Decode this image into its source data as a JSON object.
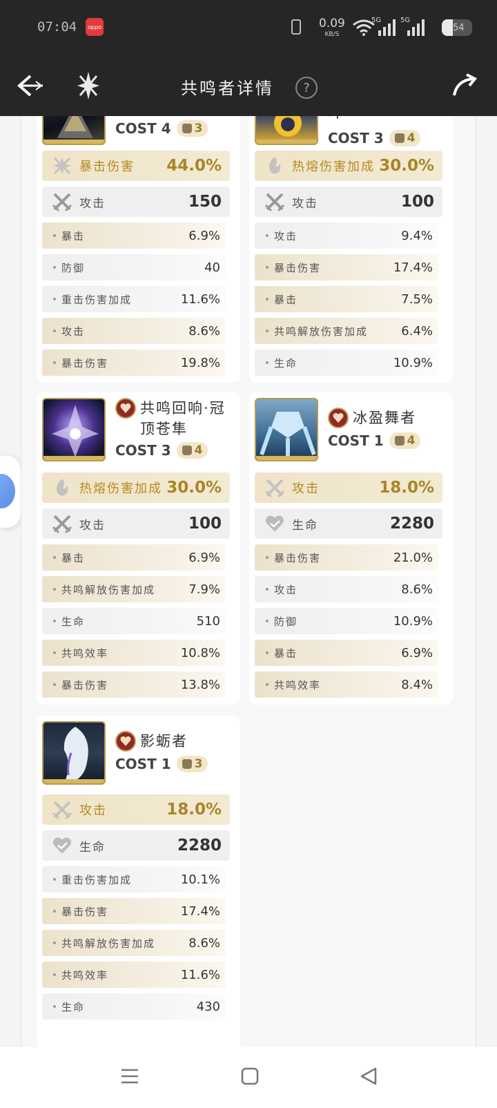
{
  "status_bar": {
    "time": "07:04",
    "app_badge": "oppo",
    "net_speed": "0.09",
    "net_unit": "KB/S",
    "sig1": "5G",
    "sig2": "5G",
    "battery": "54"
  },
  "header": {
    "title": "共鸣者详情",
    "help": "?"
  },
  "cards": [
    {
      "name": "",
      "cost": "COST 4",
      "rank": "3",
      "main": {
        "label": "暴击伤害",
        "value": "44.0%"
      },
      "sub_main": {
        "label": "攻击",
        "value": "150"
      },
      "substats": [
        {
          "label": "暴击",
          "value": "6.9%"
        },
        {
          "label": "防御",
          "value": "40"
        },
        {
          "label": "重击伤害加成",
          "value": "11.6%"
        },
        {
          "label": "攻击",
          "value": "8.6%"
        },
        {
          "label": "暴击伤害",
          "value": "19.8%"
        }
      ]
    },
    {
      "name": "叶",
      "cost": "COST 3",
      "rank": "4",
      "main": {
        "label": "热熔伤害加成",
        "value": "30.0%"
      },
      "sub_main": {
        "label": "攻击",
        "value": "100"
      },
      "substats": [
        {
          "label": "攻击",
          "value": "9.4%"
        },
        {
          "label": "暴击伤害",
          "value": "17.4%"
        },
        {
          "label": "暴击",
          "value": "7.5%"
        },
        {
          "label": "共鸣解放伤害加成",
          "value": "6.4%"
        },
        {
          "label": "生命",
          "value": "10.9%"
        }
      ]
    },
    {
      "name": "共鸣回响·冠顶苍隼",
      "cost": "COST 3",
      "rank": "4",
      "main": {
        "label": "热熔伤害加成",
        "value": "30.0%"
      },
      "sub_main": {
        "label": "攻击",
        "value": "100"
      },
      "substats": [
        {
          "label": "暴击",
          "value": "6.9%"
        },
        {
          "label": "共鸣解放伤害加成",
          "value": "7.9%"
        },
        {
          "label": "生命",
          "value": "510"
        },
        {
          "label": "共鸣效率",
          "value": "10.8%"
        },
        {
          "label": "暴击伤害",
          "value": "13.8%"
        }
      ]
    },
    {
      "name": "冰盈舞者",
      "cost": "COST 1",
      "rank": "4",
      "main": {
        "label": "攻击",
        "value": "18.0%"
      },
      "sub_main": {
        "label": "生命",
        "value": "2280"
      },
      "substats": [
        {
          "label": "暴击伤害",
          "value": "21.0%"
        },
        {
          "label": "攻击",
          "value": "8.6%"
        },
        {
          "label": "防御",
          "value": "10.9%"
        },
        {
          "label": "暴击",
          "value": "6.9%"
        },
        {
          "label": "共鸣效率",
          "value": "8.4%"
        }
      ]
    },
    {
      "name": "影蛎者",
      "cost": "COST 1",
      "rank": "3",
      "main": {
        "label": "攻击",
        "value": "18.0%"
      },
      "sub_main": {
        "label": "生命",
        "value": "2280"
      },
      "substats": [
        {
          "label": "重击伤害加成",
          "value": "10.1%"
        },
        {
          "label": "暴击伤害",
          "value": "17.4%"
        },
        {
          "label": "共鸣解放伤害加成",
          "value": "8.6%"
        },
        {
          "label": "共鸣效率",
          "value": "11.6%"
        },
        {
          "label": "生命",
          "value": "430"
        }
      ]
    }
  ],
  "colors": {
    "accent_gold": "#a88626",
    "main_stat_bg": "#efe4c8",
    "header_bg": "#262626"
  },
  "icons": {
    "back": "back-arrow-icon",
    "logo": "game-logo-icon",
    "help": "help-circle-icon",
    "share": "share-arrow-icon",
    "crit": "crit-burst-icon",
    "fusion": "fusion-flame-icon",
    "atk": "crossed-swords-icon",
    "hp": "heart-icon"
  }
}
